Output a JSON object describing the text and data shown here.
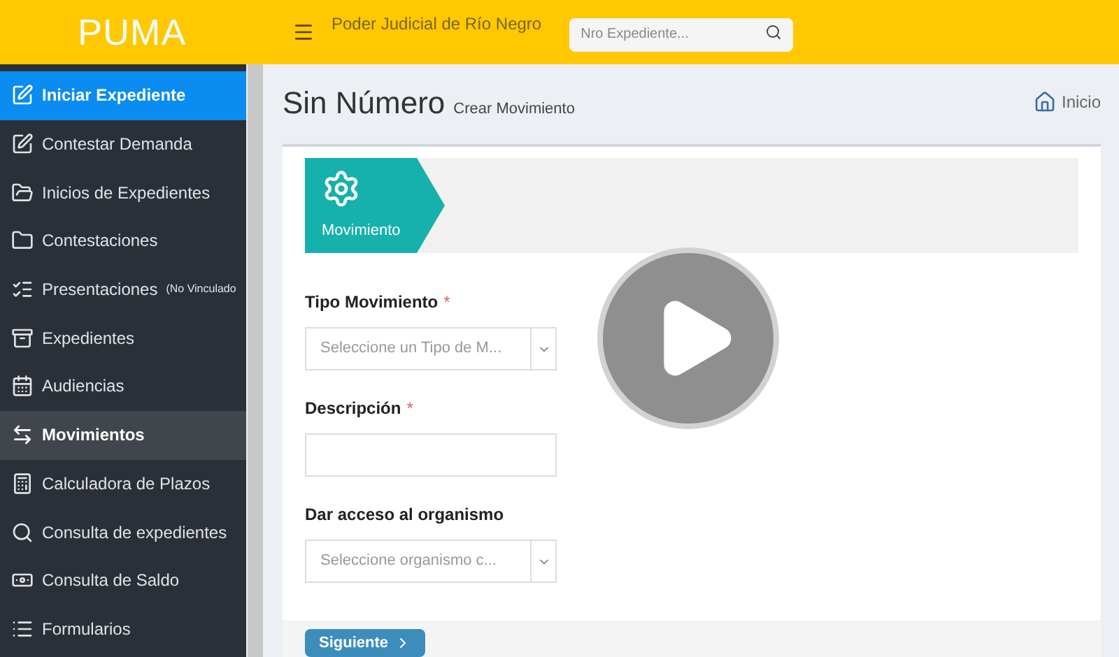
{
  "header": {
    "logo": "PUMA",
    "title": "Poder Judicial de Río Negro",
    "search": {
      "placeholder": "Nro Expediente..."
    }
  },
  "sidebar": {
    "items": [
      {
        "label": "Iniciar Expediente",
        "selected": true,
        "highlighted": false
      },
      {
        "label": "Contestar Demanda",
        "selected": false,
        "highlighted": false
      },
      {
        "label": "Inicios de Expedientes",
        "selected": false,
        "highlighted": false
      },
      {
        "label": "Contestaciones",
        "selected": false,
        "highlighted": false
      },
      {
        "label": "Presentaciones",
        "suffix": "(No Vinculado",
        "selected": false,
        "highlighted": false
      },
      {
        "label": "Expedientes",
        "selected": false,
        "highlighted": false
      },
      {
        "label": "Audiencias",
        "selected": false,
        "highlighted": false
      },
      {
        "label": "Movimientos",
        "selected": false,
        "highlighted": true
      },
      {
        "label": "Calculadora de Plazos",
        "selected": false,
        "highlighted": false
      },
      {
        "label": "Consulta de expedientes",
        "selected": false,
        "highlighted": false
      },
      {
        "label": "Consulta de Saldo",
        "selected": false,
        "highlighted": false
      },
      {
        "label": "Formularios",
        "selected": false,
        "highlighted": false
      }
    ]
  },
  "page": {
    "title": "Sin Número",
    "subtitle": "Crear Movimiento",
    "breadcrumb": "Inicio"
  },
  "wizard": {
    "steps": [
      {
        "label": "Movimiento",
        "selected": true
      }
    ]
  },
  "form": {
    "fields": [
      {
        "kind": "select",
        "label": "Tipo Movimiento",
        "required_mark": "*",
        "placeholder": "Seleccione un Tipo de M..."
      },
      {
        "kind": "text",
        "label": "Descripción",
        "required_mark": "*"
      },
      {
        "kind": "select",
        "label": "Dar acceso al organismo",
        "placeholder": "Seleccione organismo c..."
      }
    ]
  },
  "next_button": "Siguiente"
}
